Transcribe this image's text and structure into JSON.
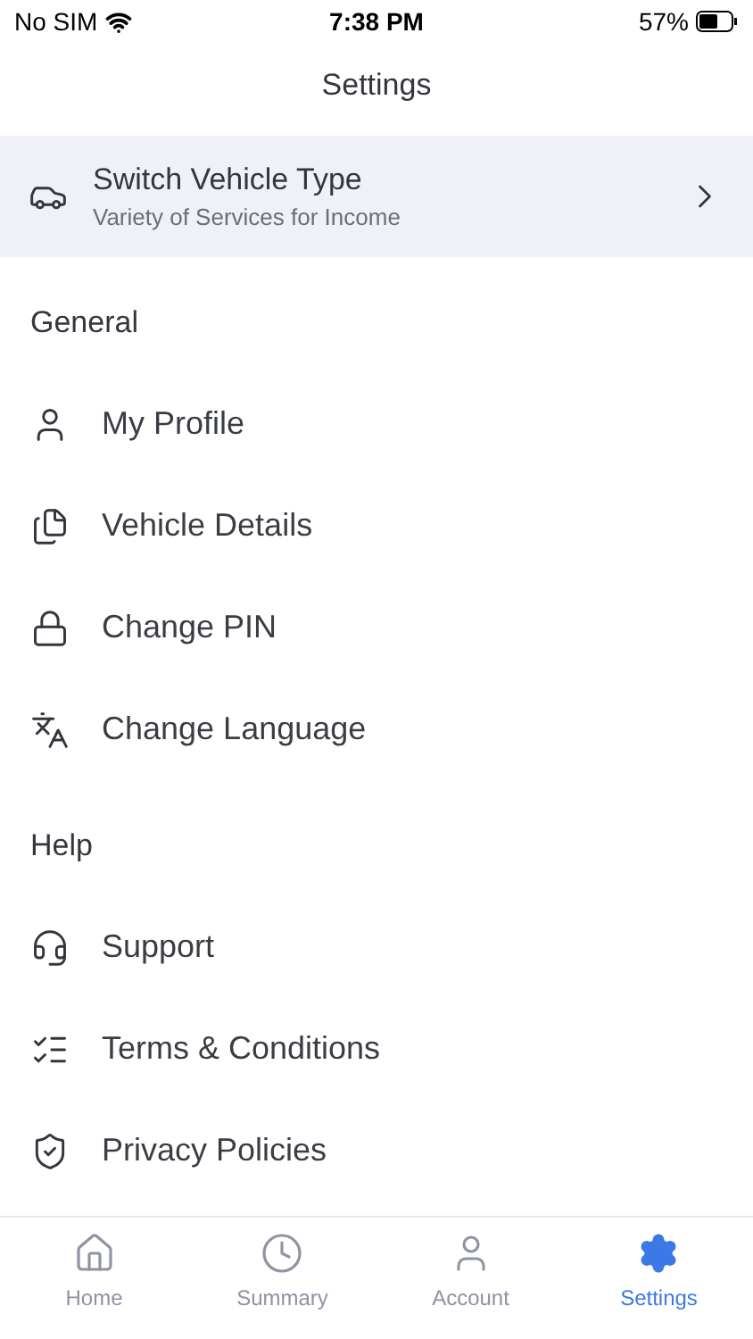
{
  "status_bar": {
    "carrier": "No SIM",
    "time": "7:38 PM",
    "battery": "57%"
  },
  "title": "Settings",
  "banner": {
    "title": "Switch Vehicle Type",
    "subtitle": "Variety of Services for Income"
  },
  "sections": [
    {
      "heading": "General",
      "items": [
        {
          "label": "My Profile"
        },
        {
          "label": "Vehicle Details"
        },
        {
          "label": "Change PIN"
        },
        {
          "label": "Change Language"
        }
      ]
    },
    {
      "heading": "Help",
      "items": [
        {
          "label": "Support"
        },
        {
          "label": "Terms & Conditions"
        },
        {
          "label": "Privacy Policies"
        }
      ]
    }
  ],
  "tabs": [
    {
      "label": "Home",
      "selected": false
    },
    {
      "label": "Summary",
      "selected": false
    },
    {
      "label": "Account",
      "selected": false
    },
    {
      "label": "Settings",
      "selected": true
    }
  ]
}
